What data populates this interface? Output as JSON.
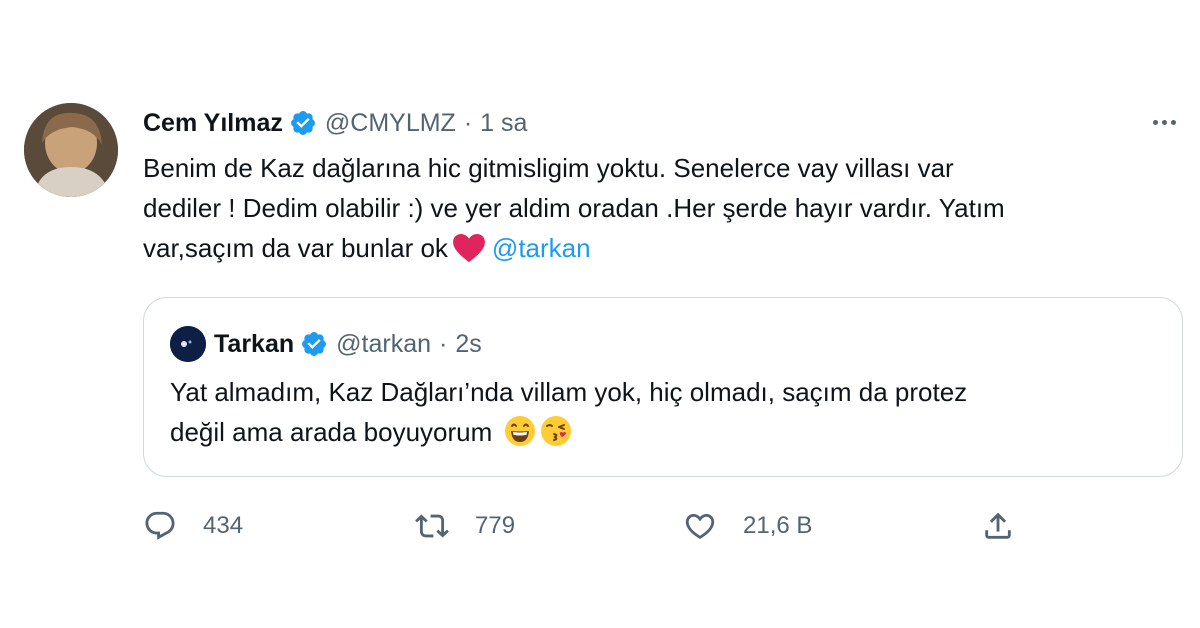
{
  "tweet": {
    "author_name": "Cem Yılmaz",
    "author_handle": "@CMYLMZ",
    "separator": "·",
    "time": "1 sa",
    "text_line1": "Benim de Kaz dağlarına hic gitmisligim yoktu. Senelerce vay villası var",
    "text_line2": "dediler ! Dedim olabilir :) ve yer aldim oradan .Her şerde hayır vardır. Yatım",
    "text_line3_before": "var,saçım da var bunlar ok",
    "mention": "@tarkan"
  },
  "quote": {
    "author_name": "Tarkan",
    "author_handle": "@tarkan",
    "separator": "·",
    "time": "2s",
    "text_line1": "Yat almadım, Kaz Dağları’nda villam yok, hiç olmadı, saçım da protez",
    "text_line2": "değil ama arada boyuyorum"
  },
  "actions": {
    "replies": "434",
    "retweets": "779",
    "likes": "21,6 B"
  },
  "colors": {
    "verified": "#1d9bf0",
    "mention": "#1d9bf0",
    "secondary_text": "#536471",
    "heart": "#e0245e"
  },
  "icons": [
    "verified-badge-icon",
    "more-options-icon",
    "red-heart-icon",
    "reply-icon",
    "retweet-icon",
    "like-icon",
    "share-icon",
    "grinning-emoji-icon",
    "kissing-emoji-icon"
  ]
}
